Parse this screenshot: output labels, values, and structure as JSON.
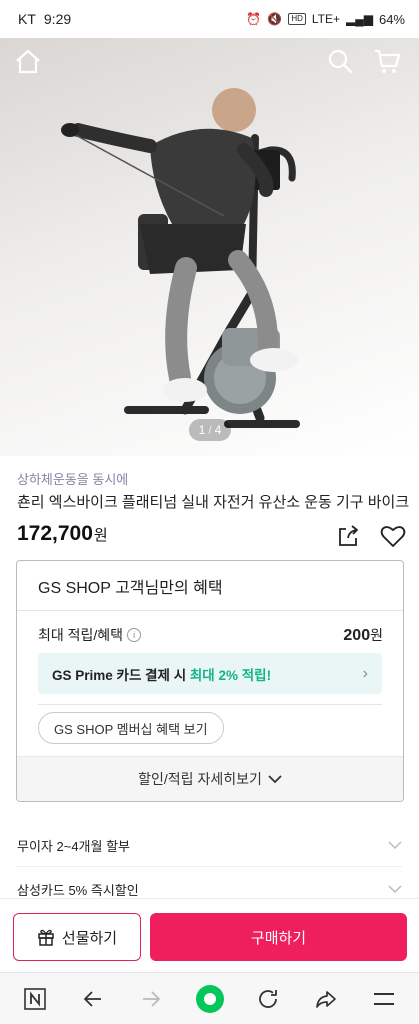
{
  "status": {
    "carrier": "KT",
    "time": "9:29",
    "hd": "HD",
    "network": "LTE+",
    "battery": "64%"
  },
  "hero": {
    "page_current": "1",
    "page_separator": "/",
    "page_total": "4"
  },
  "product": {
    "subtitle": "상하체운동을 동시에",
    "title": "쵼리 엑스바이크 플래티넘 실내 자전거 유산소 운동 기구 바이크",
    "price": "172,700",
    "currency": "원"
  },
  "benefit": {
    "heading": "GS SHOP 고객님만의 혜택",
    "reward_label": "최대 적립/혜택",
    "info_glyph": "i",
    "reward_value": "200",
    "reward_unit": "원",
    "prime_text_1": "GS Prime 카드 결제 시 ",
    "prime_text_2": "최대 2% 적립!",
    "member_button": "GS SHOP 멤버십 혜택 보기",
    "more_label": "할인/적립 자세히보기"
  },
  "rows": [
    {
      "label": "무이자 2~4개월 할부"
    },
    {
      "label": "삼성카드 5% 즉시할인"
    }
  ],
  "actions": {
    "gift_label": "선물하기",
    "buy_label": "구매하기"
  },
  "colors": {
    "accent": "#ef1f5e",
    "green": "#14b38a",
    "prime_bg": "#eaf6f6",
    "naver_green": "#03c75a"
  },
  "icons": [
    "home-icon",
    "search-icon",
    "cart-icon",
    "share-icon",
    "heart-icon",
    "gift-icon",
    "naver-icon",
    "back-icon",
    "forward-icon",
    "green-dot-icon",
    "refresh-icon",
    "share-arrow-icon",
    "menu-icon"
  ]
}
